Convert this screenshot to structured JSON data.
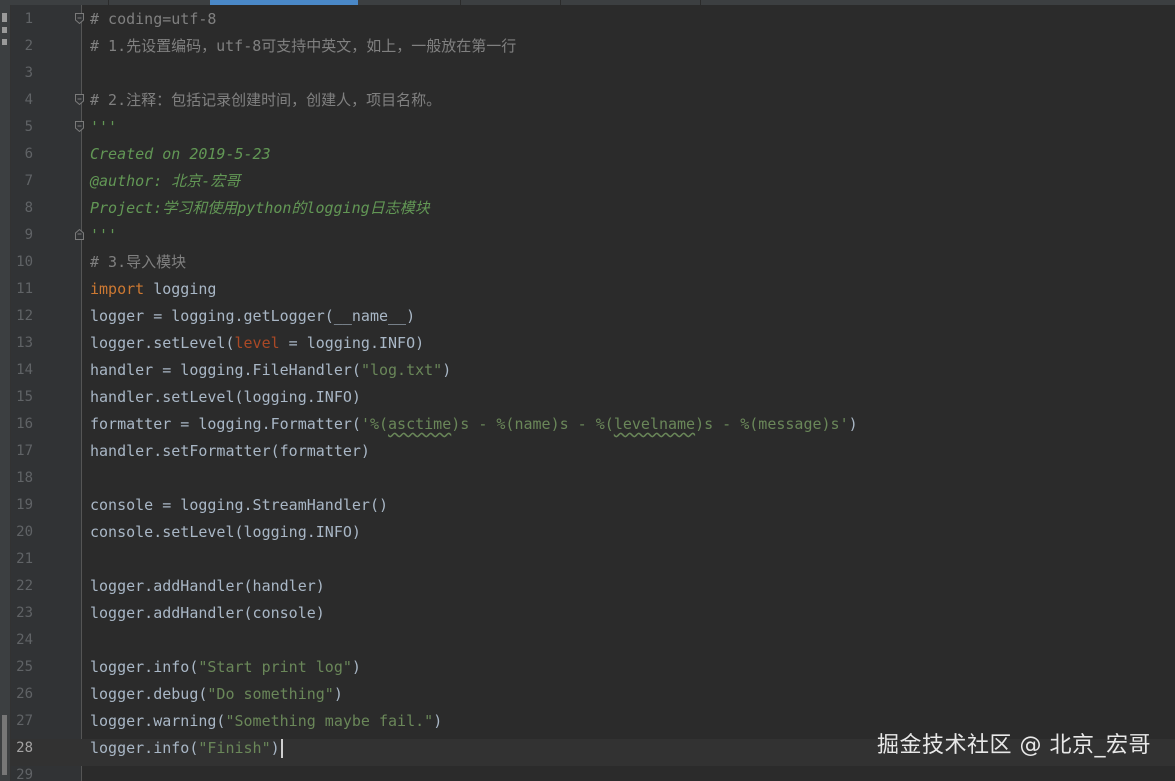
{
  "editor": {
    "current_line": 28,
    "colors": {
      "background": "#2b2b2b",
      "gutter": "#313335",
      "line_number": "#606366",
      "comment": "#808080",
      "docstring": "#629755",
      "keyword": "#cc7832",
      "string": "#6a8759",
      "param": "#aa4926",
      "default": "#a9b7c6"
    },
    "lines": [
      {
        "num": "1",
        "fold": "start",
        "tokens": [
          {
            "t": "# coding=utf-8",
            "c": "comment"
          }
        ]
      },
      {
        "num": "2",
        "tokens": [
          {
            "t": "# 1.先设置编码，utf-8可支持中英文，如上，一般放在第一行",
            "c": "comment"
          }
        ]
      },
      {
        "num": "3",
        "tokens": []
      },
      {
        "num": "4",
        "fold": "start",
        "tokens": [
          {
            "t": "# 2.注释：包括记录创建时间，创建人，项目名称。",
            "c": "comment"
          }
        ]
      },
      {
        "num": "5",
        "fold": "start",
        "tokens": [
          {
            "t": "'''",
            "c": "doc"
          }
        ]
      },
      {
        "num": "6",
        "tokens": [
          {
            "t": "Created on 2019-5-23",
            "c": "doc"
          }
        ]
      },
      {
        "num": "7",
        "tokens": [
          {
            "t": "@author: 北京-宏哥",
            "c": "doc"
          }
        ]
      },
      {
        "num": "8",
        "tokens": [
          {
            "t": "Project:学习和使用python的logging日志模块",
            "c": "doc"
          }
        ]
      },
      {
        "num": "9",
        "fold": "end",
        "tokens": [
          {
            "t": "'''",
            "c": "doc"
          }
        ]
      },
      {
        "num": "10",
        "tokens": [
          {
            "t": "# 3.导入模块",
            "c": "comment"
          }
        ]
      },
      {
        "num": "11",
        "tokens": [
          {
            "t": "import",
            "c": "keyword"
          },
          {
            "t": " logging",
            "c": "default"
          }
        ]
      },
      {
        "num": "12",
        "tokens": [
          {
            "t": "logger = logging.getLogger(__name__)",
            "c": "default"
          }
        ]
      },
      {
        "num": "13",
        "tokens": [
          {
            "t": "logger.setLevel(",
            "c": "default"
          },
          {
            "t": "level",
            "c": "param"
          },
          {
            "t": " = logging.INFO)",
            "c": "default"
          }
        ]
      },
      {
        "num": "14",
        "tokens": [
          {
            "t": "handler = logging.FileHandler(",
            "c": "default"
          },
          {
            "t": "\"log.txt\"",
            "c": "string"
          },
          {
            "t": ")",
            "c": "default"
          }
        ]
      },
      {
        "num": "15",
        "tokens": [
          {
            "t": "handler.setLevel(logging.INFO)",
            "c": "default"
          }
        ]
      },
      {
        "num": "16",
        "tokens": [
          {
            "t": "formatter = logging.Formatter(",
            "c": "default"
          },
          {
            "t": "'%(",
            "c": "string"
          },
          {
            "t": "asctime",
            "c": "string",
            "sq": true
          },
          {
            "t": ")s - %(name)s - %(",
            "c": "string"
          },
          {
            "t": "levelname",
            "c": "string",
            "sq": true
          },
          {
            "t": ")s - %(message)s'",
            "c": "string"
          },
          {
            "t": ")",
            "c": "default"
          }
        ]
      },
      {
        "num": "17",
        "tokens": [
          {
            "t": "handler.setFormatter(formatter)",
            "c": "default"
          }
        ]
      },
      {
        "num": "18",
        "tokens": []
      },
      {
        "num": "19",
        "tokens": [
          {
            "t": "console = logging.StreamHandler()",
            "c": "default"
          }
        ]
      },
      {
        "num": "20",
        "tokens": [
          {
            "t": "console.setLevel(logging.INFO)",
            "c": "default"
          }
        ]
      },
      {
        "num": "21",
        "tokens": []
      },
      {
        "num": "22",
        "tokens": [
          {
            "t": "logger.addHandler(handler)",
            "c": "default"
          }
        ]
      },
      {
        "num": "23",
        "tokens": [
          {
            "t": "logger.addHandler(console)",
            "c": "default"
          }
        ]
      },
      {
        "num": "24",
        "tokens": []
      },
      {
        "num": "25",
        "tokens": [
          {
            "t": "logger.info(",
            "c": "default"
          },
          {
            "t": "\"Start print log\"",
            "c": "string"
          },
          {
            "t": ")",
            "c": "default"
          }
        ]
      },
      {
        "num": "26",
        "tokens": [
          {
            "t": "logger.debug(",
            "c": "default"
          },
          {
            "t": "\"Do something\"",
            "c": "string"
          },
          {
            "t": ")",
            "c": "default"
          }
        ]
      },
      {
        "num": "27",
        "tokens": [
          {
            "t": "logger.warning(",
            "c": "default"
          },
          {
            "t": "\"Something maybe fail.\"",
            "c": "string"
          },
          {
            "t": ")",
            "c": "default"
          }
        ]
      },
      {
        "num": "28",
        "tokens": [
          {
            "t": "logger.info(",
            "c": "default"
          },
          {
            "t": "\"Finish\"",
            "c": "string"
          },
          {
            "t": ")",
            "c": "default"
          }
        ],
        "caret": true
      },
      {
        "num": "29",
        "tokens": []
      }
    ]
  },
  "watermark": {
    "text": "掘金技术社区 @ 北京_宏哥"
  }
}
